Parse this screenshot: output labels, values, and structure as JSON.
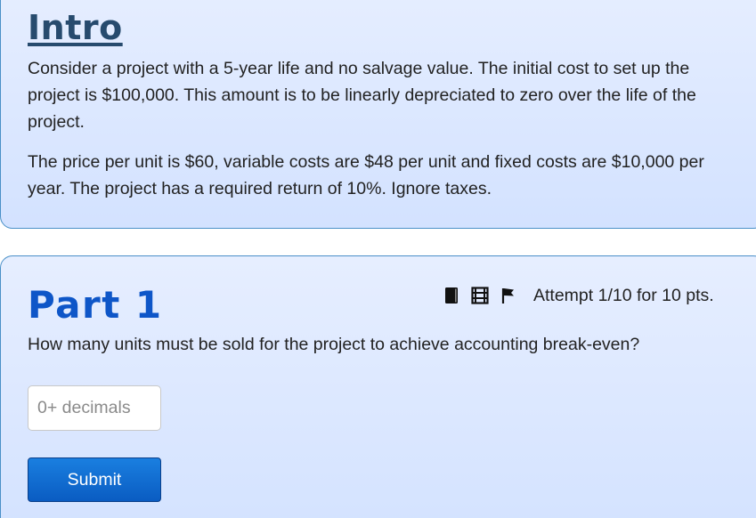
{
  "intro": {
    "title": "Intro",
    "paragraph1": "Consider a project with a 5-year life and no salvage value. The initial cost to set up the project is $100,000. This amount is to be linearly depreciated to zero over the life of the project.",
    "paragraph2": "The price per unit is $60, variable costs are $48 per unit and fixed costs are $10,000 per year. The project has a required return of 10%. Ignore taxes."
  },
  "part": {
    "title": "Part 1",
    "toolbar": {
      "icons": [
        "book-icon",
        "film-icon",
        "flag-icon"
      ],
      "attempt": "Attempt 1/10 for 10 pts."
    },
    "question": "How many units must be sold for the project to achieve accounting break-even?",
    "answer": {
      "value": "",
      "placeholder": "0+ decimals"
    },
    "submit_label": "Submit"
  },
  "colors": {
    "card_bg_top": "#e6eeff",
    "card_bg_bottom": "#d3e2ff",
    "card_border": "#4a90c8",
    "intro_title": "#274b6e",
    "part_title": "#0e56c8",
    "button": "#0a5cc2"
  }
}
